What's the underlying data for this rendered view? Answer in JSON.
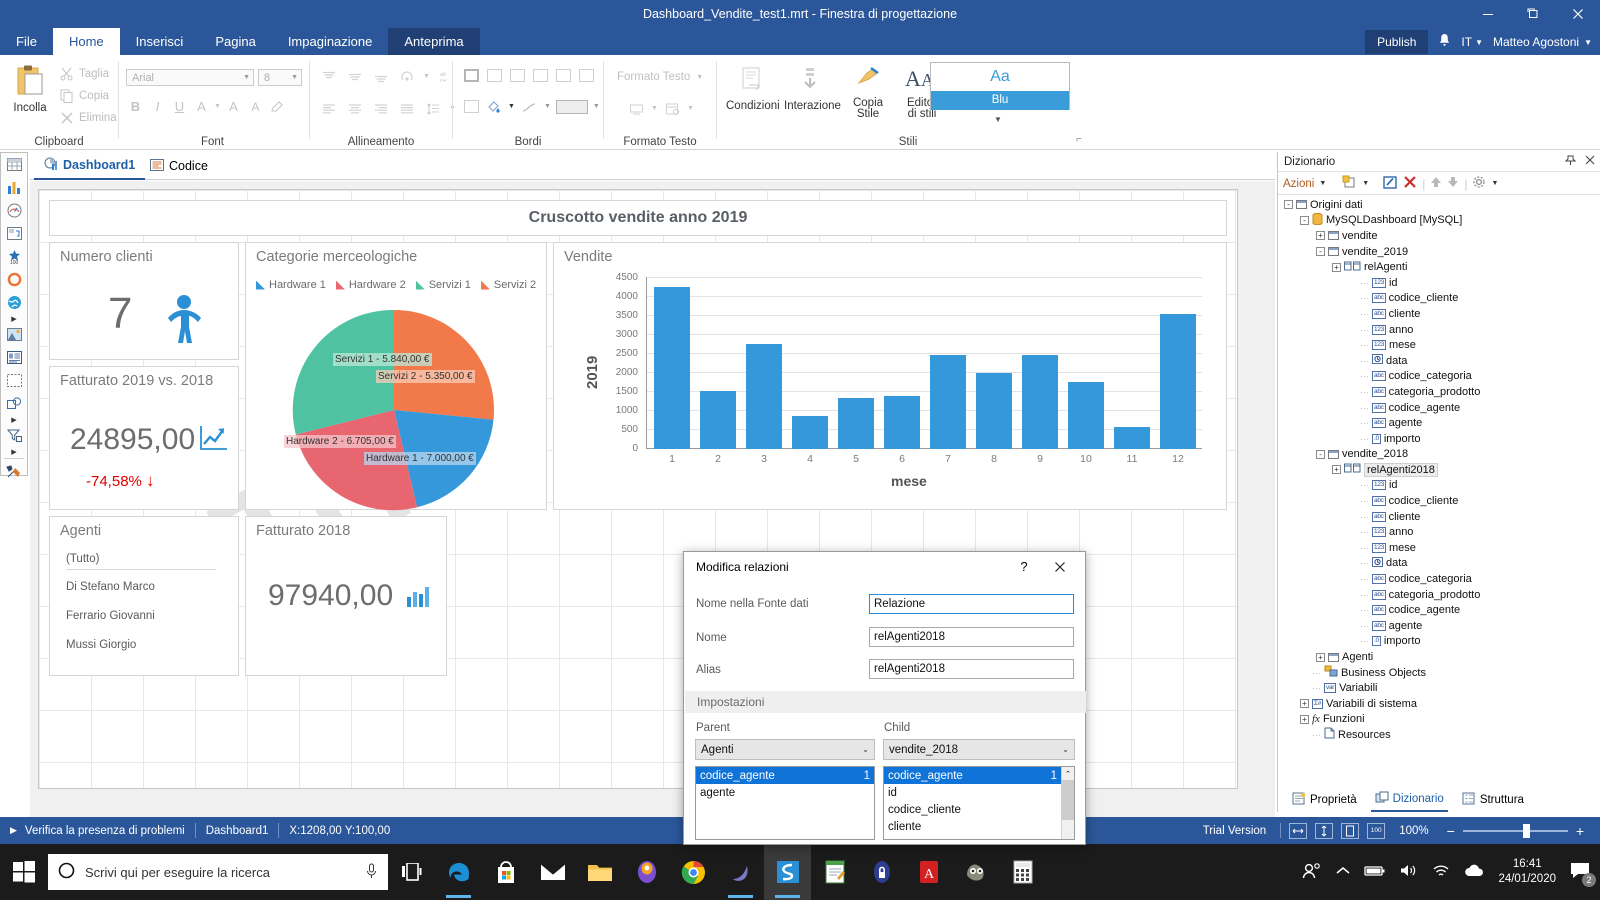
{
  "window": {
    "title": "Dashboard_Vendite_test1.mrt - Finestra di progettazione",
    "minimize": "—",
    "maximize": "❐",
    "close": "✕"
  },
  "ribbon": {
    "tabs": [
      {
        "label": "File",
        "state": "normal"
      },
      {
        "label": "Home",
        "state": "active"
      },
      {
        "label": "Inserisci",
        "state": "normal"
      },
      {
        "label": "Pagina",
        "state": "normal"
      },
      {
        "label": "Impaginazione",
        "state": "normal"
      },
      {
        "label": "Anteprima",
        "state": "highlight"
      }
    ],
    "account": {
      "publish": "Publish",
      "language": "IT",
      "user": "Matteo Agostoni"
    },
    "groups": [
      {
        "name": "Clipboard"
      },
      {
        "name": "Font"
      },
      {
        "name": "Allineamento"
      },
      {
        "name": "Bordi"
      },
      {
        "name": "Formato Testo"
      },
      {
        "name": "Stili"
      }
    ],
    "clipboard": {
      "paste": "Incolla",
      "cut": "Taglia",
      "copy": "Copia",
      "delete": "Elimina"
    },
    "font": {
      "family_value": "Arial",
      "size_value": "8",
      "bold": "B",
      "italic": "I",
      "underline": "U",
      "color": "A",
      "grow": "A",
      "shrink": "A"
    },
    "text_format": {
      "label": "Formato Testo"
    },
    "styles": {
      "conditions": "Condizioni",
      "interaction": "Interazione",
      "copy_style": "Copia\nStile",
      "copy_style_l1": "Copia",
      "copy_style_l2": "Stile",
      "style_editor_l1": "Editor",
      "style_editor_l2": "di stili",
      "preview_aa": "Aa",
      "preview_name": "Blu"
    }
  },
  "doc_tabs": [
    {
      "label": "Dashboard1",
      "icon": "dashboard-icon",
      "active": true
    },
    {
      "label": "Codice",
      "icon": "code-icon",
      "active": false
    }
  ],
  "dashboard": {
    "header_title": "Cruscotto vendite anno 2019",
    "watermark": "Trial",
    "panels": {
      "clients": {
        "title": "Numero clienti",
        "value": "7",
        "icon": "person-icon"
      },
      "revenue_compare": {
        "title": "Fatturato 2019 vs. 2018",
        "value": "24895,00",
        "delta": "-74,58%",
        "delta_arrow": "↓",
        "icon": "trend-chart-icon"
      },
      "categories": {
        "title": "Categorie merceologiche"
      },
      "sales": {
        "title": "Vendite"
      },
      "agents": {
        "title": "Agenti",
        "items": [
          "(Tutto)",
          "Di Stefano Marco",
          "Ferrario Giovanni",
          "Mussi Giorgio"
        ]
      },
      "revenue_2018": {
        "title": "Fatturato 2018",
        "value": "97940,00",
        "icon": "bar-chart-icon"
      }
    }
  },
  "chart_data": [
    {
      "type": "pie",
      "title": "Categorie merceologiche",
      "legend_position": "top",
      "labels": [
        "Hardware 1",
        "Hardware 2",
        "Servizi 1",
        "Servizi 2"
      ],
      "values": [
        7000.0,
        6705.0,
        5840.0,
        5350.0
      ],
      "value_labels": [
        "Hardware 1 - 7.000,00 €",
        "Hardware 2 - 6.705,00 €",
        "Servizi 1 - 5.840,00 €",
        "Servizi 2 - 5.350,00 €"
      ],
      "colors": [
        "#3498db",
        "#e8666f",
        "#4fc3a1",
        "#f1794a"
      ]
    },
    {
      "type": "bar",
      "title": "Vendite",
      "xlabel": "mese",
      "ylabel": "2019",
      "categories": [
        "1",
        "2",
        "3",
        "4",
        "5",
        "6",
        "7",
        "8",
        "9",
        "10",
        "11",
        "12"
      ],
      "values": [
        4270,
        1505,
        2735,
        845,
        1330,
        1375,
        2445,
        1970,
        2445,
        1735,
        590,
        3550
      ],
      "ylim": [
        0,
        4500
      ],
      "yticks": [
        "0",
        "500",
        "1000",
        "1500",
        "2000",
        "2500",
        "3000",
        "3500",
        "4000",
        "4500"
      ],
      "grid": true,
      "series_color": "#3498db"
    }
  ],
  "dictionary": {
    "panel_title": "Dizionario",
    "pin_icon": "pin-icon",
    "close_icon": "close-icon",
    "toolbar": {
      "actions": "Azioni",
      "new_icon": "new-item-icon",
      "edit_icon": "edit-icon",
      "delete_icon": "delete-icon",
      "up_icon": "move-up-icon",
      "down_icon": "move-down-icon",
      "settings_icon": "gear-icon"
    },
    "tree": [
      {
        "label": "Origini dati",
        "indent": 0,
        "expander": "-",
        "icon": "grid-icon"
      },
      {
        "label": "MySQLDashboard [MySQL]",
        "indent": 1,
        "expander": "-",
        "icon": "database-icon"
      },
      {
        "label": "vendite",
        "indent": 2,
        "expander": "+",
        "icon": "grid-icon"
      },
      {
        "label": "vendite_2019",
        "indent": 2,
        "expander": "-",
        "icon": "grid-icon"
      },
      {
        "label": "relAgenti",
        "indent": 3,
        "expander": "+",
        "icon": "relation-icon"
      },
      {
        "label": "id",
        "indent": 4,
        "expander": "",
        "icon": "123"
      },
      {
        "label": "codice_cliente",
        "indent": 4,
        "expander": "",
        "icon": "abc"
      },
      {
        "label": "cliente",
        "indent": 4,
        "expander": "",
        "icon": "abc"
      },
      {
        "label": "anno",
        "indent": 4,
        "expander": "",
        "icon": "123"
      },
      {
        "label": "mese",
        "indent": 4,
        "expander": "",
        "icon": "123"
      },
      {
        "label": "data",
        "indent": 4,
        "expander": "",
        "icon": "clock"
      },
      {
        "label": "codice_categoria",
        "indent": 4,
        "expander": "",
        "icon": "abc"
      },
      {
        "label": "categoria_prodotto",
        "indent": 4,
        "expander": "",
        "icon": "abc"
      },
      {
        "label": "codice_agente",
        "indent": 4,
        "expander": "",
        "icon": "abc"
      },
      {
        "label": "agente",
        "indent": 4,
        "expander": "",
        "icon": "abc"
      },
      {
        "label": "importo",
        "indent": 4,
        "expander": "",
        "icon": ".0"
      },
      {
        "label": "vendite_2018",
        "indent": 2,
        "expander": "-",
        "icon": "grid-icon"
      },
      {
        "label": "relAgenti2018",
        "indent": 3,
        "expander": "+",
        "icon": "relation-icon",
        "selected": true
      },
      {
        "label": "id",
        "indent": 4,
        "expander": "",
        "icon": "123"
      },
      {
        "label": "codice_cliente",
        "indent": 4,
        "expander": "",
        "icon": "abc"
      },
      {
        "label": "cliente",
        "indent": 4,
        "expander": "",
        "icon": "abc"
      },
      {
        "label": "anno",
        "indent": 4,
        "expander": "",
        "icon": "123"
      },
      {
        "label": "mese",
        "indent": 4,
        "expander": "",
        "icon": "123"
      },
      {
        "label": "data",
        "indent": 4,
        "expander": "",
        "icon": "clock"
      },
      {
        "label": "codice_categoria",
        "indent": 4,
        "expander": "",
        "icon": "abc"
      },
      {
        "label": "categoria_prodotto",
        "indent": 4,
        "expander": "",
        "icon": "abc"
      },
      {
        "label": "codice_agente",
        "indent": 4,
        "expander": "",
        "icon": "abc"
      },
      {
        "label": "agente",
        "indent": 4,
        "expander": "",
        "icon": "abc"
      },
      {
        "label": "importo",
        "indent": 4,
        "expander": "",
        "icon": ".0"
      },
      {
        "label": "Agenti",
        "indent": 2,
        "expander": "+",
        "icon": "grid-icon"
      },
      {
        "label": "Business Objects",
        "indent": 1,
        "expander": "",
        "icon": "bo-icon"
      },
      {
        "label": "Variabili",
        "indent": 1,
        "expander": "",
        "icon": "var-icon"
      },
      {
        "label": "Variabili di sistema",
        "indent": 1,
        "expander": "+",
        "icon": "sysvar-icon"
      },
      {
        "label": "Funzioni",
        "indent": 1,
        "expander": "+",
        "icon": "fx-icon"
      },
      {
        "label": "Resources",
        "indent": 1,
        "expander": "",
        "icon": "resources-icon"
      }
    ],
    "bottom_tabs": [
      {
        "label": "Proprietà",
        "active": false,
        "icon": "properties-icon"
      },
      {
        "label": "Dizionario",
        "active": true,
        "icon": "dictionary-icon"
      },
      {
        "label": "Struttura",
        "active": false,
        "icon": "structure-icon"
      }
    ]
  },
  "dialog": {
    "title": "Modifica relazioni",
    "help": "?",
    "close": "✕",
    "fields": [
      {
        "label": "Nome nella Fonte dati",
        "value": "Relazione",
        "focused": true
      },
      {
        "label": "Nome",
        "value": "relAgenti2018",
        "focused": false
      },
      {
        "label": "Alias",
        "value": "relAgenti2018",
        "focused": false
      }
    ],
    "settings_header": "Impostazioni",
    "parent": {
      "label": "Parent",
      "selected": "Agenti",
      "columns": [
        {
          "name": "codice_agente",
          "num": "1",
          "selected": true
        },
        {
          "name": "agente",
          "num": "",
          "selected": false
        }
      ]
    },
    "child": {
      "label": "Child",
      "selected": "vendite_2018",
      "columns": [
        {
          "name": "codice_agente",
          "num": "1",
          "selected": true
        },
        {
          "name": "id",
          "num": "",
          "selected": false
        },
        {
          "name": "codice_cliente",
          "num": "",
          "selected": false
        },
        {
          "name": "cliente",
          "num": "",
          "selected": false
        }
      ]
    }
  },
  "statusbar": {
    "check_problems": "Verifica la presenza di problemi",
    "page_name": "Dashboard1",
    "coords": "X:1208,00 Y:100,00",
    "trial": "Trial Version",
    "zoom": "100%",
    "zoom_out": "−",
    "zoom_in": "+"
  },
  "taskbar": {
    "search_placeholder": "Scrivi qui per eseguire la ricerca",
    "time": "16:41",
    "date": "24/01/2020",
    "notification_count": "2",
    "apps": [
      {
        "name": "task-view-icon"
      },
      {
        "name": "edge-icon"
      },
      {
        "name": "microsoft-store-icon"
      },
      {
        "name": "mail-icon"
      },
      {
        "name": "file-explorer-icon"
      },
      {
        "name": "firefox-icon"
      },
      {
        "name": "chrome-icon"
      },
      {
        "name": "mysql-workbench-icon"
      },
      {
        "name": "stimulsoft-icon"
      },
      {
        "name": "notepad-icon"
      },
      {
        "name": "keepass-icon"
      },
      {
        "name": "acrobat-icon"
      },
      {
        "name": "gimp-icon"
      },
      {
        "name": "calculator-icon"
      }
    ]
  }
}
